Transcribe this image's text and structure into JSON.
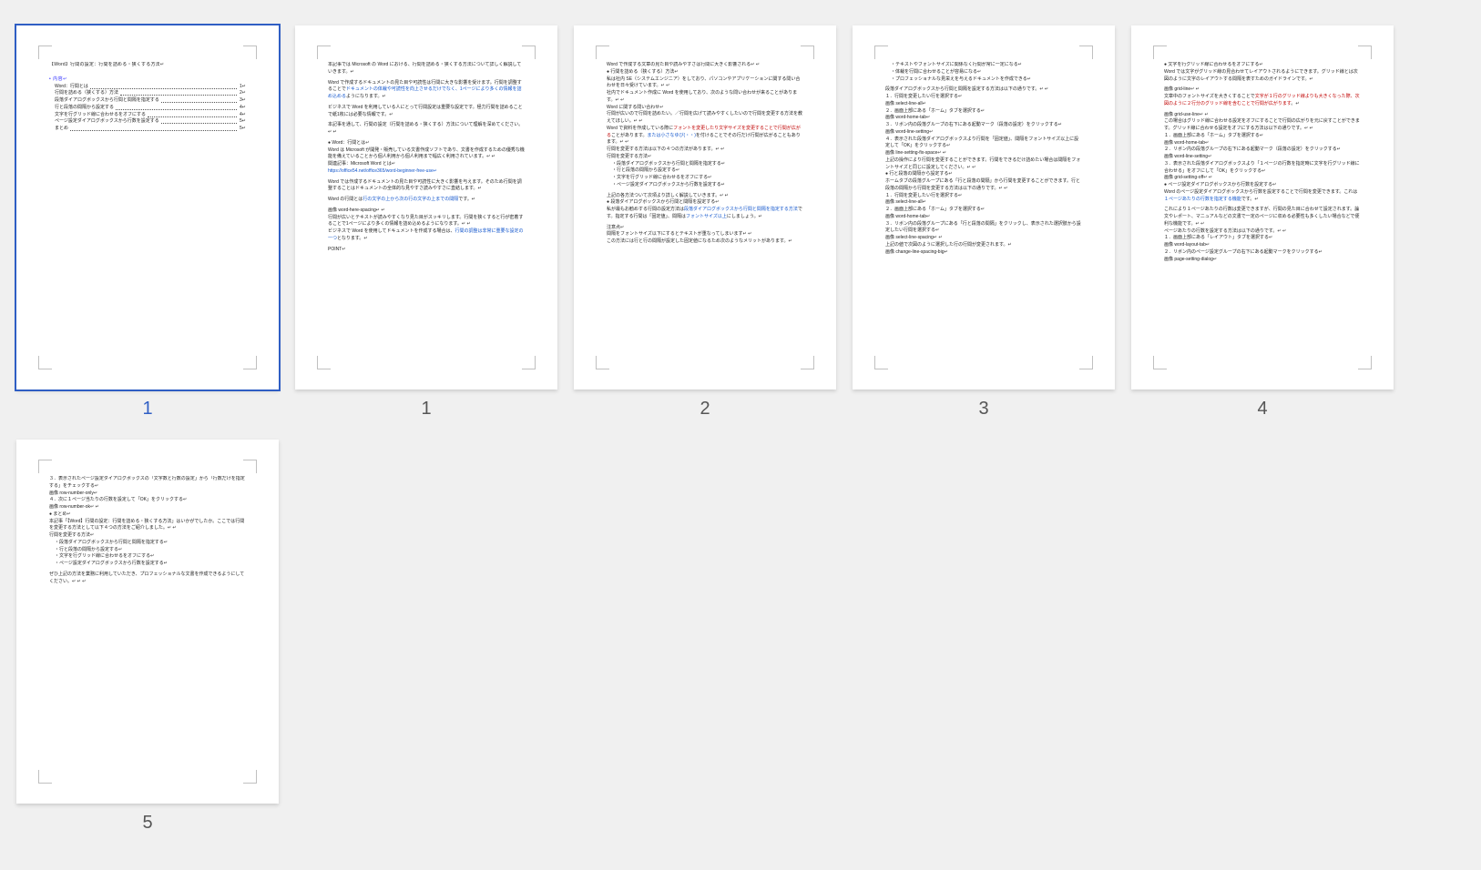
{
  "pages": [
    {
      "num": "1",
      "selected": true,
      "kind": "cover",
      "title": "【Word】行間の設定：行間を詰める・狭くする方法↵",
      "tocHead": "• 内容↵",
      "toc": [
        [
          "Word：行間とは",
          "1↵"
        ],
        [
          "行間を詰める（狭くする）方法",
          "2↵"
        ],
        [
          "段落ダイアログボックスから行間と間隔を指定する",
          "3↵"
        ],
        [
          "行と段落の間隔から設定する",
          "4↵"
        ],
        [
          "文字を行グリッド線に合わせるをオフにする",
          "4↵"
        ],
        [
          "ページ設定ダイアログボックスから行数を設定する",
          "5↵"
        ],
        [
          "まとめ",
          "5↵"
        ]
      ]
    },
    {
      "num": "1",
      "kind": "body",
      "blocks": [
        {
          "t": "p",
          "v": "本記事では Microsoft の Word における、行間を詰める・狭くする方法について詳しく解説していきます。↵"
        },
        {
          "t": "sp"
        },
        {
          "t": "mix",
          "parts": [
            {
              "v": "Word で作成するドキュメントの見た目や可読性は行間に大きな影響を受けます。行間を調整することで"
            },
            {
              "v": "ドキュメントの体裁や可読性を向上させるだけでなく、1ページにより多くの情報を詰め込める",
              "c": "lnk"
            },
            {
              "v": "ようになります。↵"
            }
          ]
        },
        {
          "t": "sp"
        },
        {
          "t": "p",
          "v": "ビジネスで Word を利用している人にとって行間設定は重要な設定です。極力行間を詰めることで紙1枚には必要な情報です。↵"
        },
        {
          "t": "sp"
        },
        {
          "t": "p",
          "v": "本記事を通して、行間の設定（行間を詰める・狭くする）方法について理解を深めてください。↵  ↵"
        },
        {
          "t": "sp"
        },
        {
          "t": "b",
          "v": "Word：行間とは↵"
        },
        {
          "t": "p",
          "v": "Word は Microsoft が開発・販売している文書作成ソフトであり、文書を作成するための優秀な機能を備えていることから個人利用から個人利用まで幅広く利用されています。↵  ↵"
        },
        {
          "t": "p",
          "v": "関連記事：Microsoft Word とは↵"
        },
        {
          "t": "p",
          "v": "https://office54.net/office365/word-beginner-free-use↵",
          "c": "lnk"
        },
        {
          "t": "sp"
        },
        {
          "t": "p",
          "v": "Word では作成するドキュメントの見た目や可読性に大きく影響を与えます。そのため行間を調整することはドキュメントの全体的な見やすさ読みやすさに直結します。↵"
        },
        {
          "t": "sp"
        },
        {
          "t": "mix",
          "parts": [
            {
              "v": "Word の行間とは"
            },
            {
              "v": "行の文字の上から次の行の文字の上までの間隔",
              "c": "lnk"
            },
            {
              "v": "です。↵"
            }
          ]
        },
        {
          "t": "sp"
        },
        {
          "t": "p",
          "v": "画像  word-here-spacing↵  ↵"
        },
        {
          "t": "p",
          "v": "行間が広いとテキストが読みやすくなり見た目がスッキリします。行間を狭くすると行が密着することで1ページにより多くの情報を詰め込めるようになります。↵  ↵"
        },
        {
          "t": "mix",
          "parts": [
            {
              "v": "ビジネスで Word を使用してドキュメントを作成する場合は、"
            },
            {
              "v": "行間の調整は非常に重要な設定の一つ",
              "c": "lnk"
            },
            {
              "v": "となります。↵"
            }
          ]
        },
        {
          "t": "sp"
        },
        {
          "t": "p",
          "v": "POINT↵"
        }
      ]
    },
    {
      "num": "2",
      "kind": "body",
      "blocks": [
        {
          "t": "p",
          "v": "Word で作成する文章の見た目や読みやすさは行間に大きく影響される↵  ↵"
        },
        {
          "t": "b",
          "v": "行間を詰める（狭くする）方法↵"
        },
        {
          "t": "p",
          "v": "私は社内 SE（システムエンジニア）をしており、パソコンやアプリケーションに関する問い合わせを日々受けています。↵  ↵"
        },
        {
          "t": "p",
          "v": "社内でドキュメント作成に Word を使用しており、次のような問い合わせが来ることがあります。↵  ↵"
        },
        {
          "t": "p",
          "v": "Word に関する問い合わせ↵"
        },
        {
          "t": "p",
          "v": "行間が広いので行間を詰めたい。／行間を広げて読みやすくしたいので行間を変更する方法を教えてほしい。↵  ↵"
        },
        {
          "t": "mix",
          "parts": [
            {
              "v": "Word で資料を作成している際に"
            },
            {
              "v": "フォントを変更したり文字サイズを変更することで行間が広がる",
              "c": "red"
            },
            {
              "v": "ことがあります。"
            },
            {
              "v": "または小さなゆび(・・)",
              "c": "lnk"
            },
            {
              "v": "を付けることでその行だけ行間が広がることもあります。↵  ↵"
            }
          ]
        },
        {
          "t": "p",
          "v": "行間を変更する方法は以下の４つの方法があります。↵  ↵"
        },
        {
          "t": "p",
          "v": "行間を変更する方法↵"
        },
        {
          "t": "d",
          "v": "段落ダイアログボックスから行間と間隔を指定する↵"
        },
        {
          "t": "d",
          "v": "行と段落の間隔から設定する↵"
        },
        {
          "t": "d",
          "v": "文字を行グリッド線に合わせるをオフにする↵"
        },
        {
          "t": "d",
          "v": "ページ設定ダイアログボックスから行数を設定する↵"
        },
        {
          "t": "sp"
        },
        {
          "t": "p",
          "v": "上記の各方法ついて次項より詳しく解説していきます。↵  ↵"
        },
        {
          "t": "b",
          "v": "段落ダイアログボックスから行間と間隔を設定する↵"
        },
        {
          "t": "mix",
          "parts": [
            {
              "v": "私が最もお勧めする行間の設定方法は"
            },
            {
              "v": "段落ダイアログボックスから行間と間隔を指定する方法",
              "c": "lnk"
            },
            {
              "v": "です。指定する行間は「固定値」、間隔は"
            },
            {
              "v": "フォントサイズ以上",
              "c": "lnk"
            },
            {
              "v": "にしましょう。↵"
            }
          ]
        },
        {
          "t": "sp"
        },
        {
          "t": "p",
          "v": "注意点↵"
        },
        {
          "t": "p",
          "v": "間隔をフォントサイズ以下にするとテキストが重なってしまいます↵  ↵"
        },
        {
          "t": "p",
          "v": "この方法には行と行の間隔が設定した固定値になるため次のようなメリットがあります。↵"
        }
      ]
    },
    {
      "num": "3",
      "kind": "body",
      "blocks": [
        {
          "t": "d",
          "v": "テキストやフォントサイズに関係なく行間が常に一定になる↵"
        },
        {
          "t": "d",
          "v": "体裁を行間に合わせることが容易になる↵"
        },
        {
          "t": "d",
          "v": "プロフェッショナルな見栄えを与えるドキュメントを作成できる↵"
        },
        {
          "t": "sp"
        },
        {
          "t": "p",
          "v": "段落ダイアログボックスから行間と間隔を設定する方法は以下の通りです。↵  ↵"
        },
        {
          "t": "p",
          "v": "１．行間を変更したい行を選択する↵"
        },
        {
          "t": "p",
          "v": "画像  select-line-all↵"
        },
        {
          "t": "p",
          "v": "２．画面上部にある「ホーム」タブを選択する↵"
        },
        {
          "t": "p",
          "v": "画像  word-home-tab↵"
        },
        {
          "t": "p",
          "v": "３．リボン内の段落グループの右下にある起動マーク（段落の設定）をクリックする↵"
        },
        {
          "t": "p",
          "v": "画像  word-line-setting↵"
        },
        {
          "t": "p",
          "v": "４．表示された段落ダイアログボックスより行間を「固定値」、間隔をフォントサイズ以上に設定して「OK」をクリックする↵"
        },
        {
          "t": "p",
          "v": "画像  line-setting-fix-space↵  ↵"
        },
        {
          "t": "p",
          "v": "上記の操作により行間を変更することができます。行間をできるだけ詰めたい場合は間隔をフォントサイズと同じに設定してください。↵  ↵"
        },
        {
          "t": "b",
          "v": "行と段落の間隔から設定する↵"
        },
        {
          "t": "p",
          "v": "ホームタブの段落グループにある「行と段落の間隔」から行間を変更することができます。行と段落の間隔から行間を変更する方法は以下の通りです。↵  ↵"
        },
        {
          "t": "p",
          "v": "１．行間を変更したい行を選択する↵"
        },
        {
          "t": "p",
          "v": "画像  select-line-all↵"
        },
        {
          "t": "p",
          "v": "２．画面上部にある「ホーム」タブを選択する↵"
        },
        {
          "t": "p",
          "v": "画像  word-home-tab↵"
        },
        {
          "t": "p",
          "v": "３．リボン内の段落グループにある「行と段落の間隔」をクリックし、表示された選択肢から設定したい行間を選択する↵"
        },
        {
          "t": "p",
          "v": "画像  select-line-spacing↵  ↵"
        },
        {
          "t": "p",
          "v": "上記の値で次図のように選択した行の行間が変更されます。↵"
        },
        {
          "t": "p",
          "v": "画像  change-line-spacing-big↵"
        }
      ]
    },
    {
      "num": "4",
      "kind": "body",
      "blocks": [
        {
          "t": "b",
          "v": "文字を行グリッド線に合わせるをオフにする↵"
        },
        {
          "t": "p",
          "v": "Word では文字がグリッド線の見合わせてレイアウトされるようにできます。グリッド線とは次図のように文字のレイアウトする間隔を表すためのガイドラインです。↵"
        },
        {
          "t": "sp"
        },
        {
          "t": "p",
          "v": "画像  grid-line↵  ↵"
        },
        {
          "t": "mix",
          "parts": [
            {
              "v": "文章中のフォントサイズを大きくすることで"
            },
            {
              "v": "文字が１行のグリッド線よりも大きくなった際、次図のように２行分のグリッド線を含むことで行間が広がります",
              "c": "red"
            },
            {
              "v": "。↵"
            }
          ]
        },
        {
          "t": "sp"
        },
        {
          "t": "p",
          "v": "画像  grid-use-line↵  ↵"
        },
        {
          "t": "p",
          "v": "この場合はグリッド線に合わせる設定をオフにすることで行間の広がりを元に戻すことができます。グリッド線に合わせる設定をオフにする方法は以下の通りです。↵  ↵"
        },
        {
          "t": "p",
          "v": "１．画面上部にある「ホーム」タブを選択する↵"
        },
        {
          "t": "p",
          "v": "画像  word-home-tab↵"
        },
        {
          "t": "p",
          "v": "２．リボン内の段落グループの右下にある起動マーク（段落の設定）をクリックする↵"
        },
        {
          "t": "p",
          "v": "画像  word-line-setting↵"
        },
        {
          "t": "p",
          "v": "３．表示された段落ダイアログボックスより「１ページの行数を指定時に文字を行グリッド線に合わせる」をオフにして「OK」をクリックする↵"
        },
        {
          "t": "p",
          "v": "画像  grid-setting-off↵  ↵"
        },
        {
          "t": "b",
          "v": "ページ設定ダイアログボックスから行数を設定する↵"
        },
        {
          "t": "mix",
          "parts": [
            {
              "v": "Word のページ設定ダイアログボックスから行数を設定することで行間を変更できます。これは"
            },
            {
              "v": "１ページあたりの行数を指定する機能",
              "c": "lnk"
            },
            {
              "v": "です。↵"
            }
          ]
        },
        {
          "t": "sp"
        },
        {
          "t": "p",
          "v": "これにより１ページあたりの行数は変更できますが、行間の見た目に合わせて設定されます。論文やレポート、マニュアルなどの文書で一定のページに収める必要性も多くしたい場合などで便利な機能です。↵  ↵"
        },
        {
          "t": "p",
          "v": "ページあたりの行数を設定する方法は以下の通りです。↵  ↵"
        },
        {
          "t": "p",
          "v": "１．画面上部にある「レイアウト」タブを選択する↵"
        },
        {
          "t": "p",
          "v": "画像  word-layout-tab↵"
        },
        {
          "t": "p",
          "v": "２．リボン内のページ設定グループの右下にある起動マークをクリックする↵"
        },
        {
          "t": "p",
          "v": "画像  page-setting-dialog↵"
        }
      ]
    },
    {
      "num": "5",
      "kind": "body",
      "blocks": [
        {
          "t": "p",
          "v": "３．表示されたページ設定ダイアログボックスの「文字数と行数の設定」から「行数だけを指定する」をチェックする↵"
        },
        {
          "t": "p",
          "v": "画像  row-number-only↵"
        },
        {
          "t": "p",
          "v": "４．次に１ページ当たりの行数を設定して「OK」をクリックする↵"
        },
        {
          "t": "p",
          "v": "画像  row-number-ok↵  ↵"
        },
        {
          "t": "b",
          "v": "まとめ↵"
        },
        {
          "t": "p",
          "v": "本記事「【Word】行間の設定：行間を詰める・狭くする方法」はいかがでしたか。ここでは行間を変更する方法として以下４つの方法をご紹介しました。↵  ↵"
        },
        {
          "t": "p",
          "v": "行間を変更する方法↵"
        },
        {
          "t": "d",
          "v": "段落ダイアログボックスから行間と間隔を指定する↵"
        },
        {
          "t": "d",
          "v": "行と段落の間隔から設定する↵"
        },
        {
          "t": "d",
          "v": "文字を行グリッド線に合わせるをオフにする↵"
        },
        {
          "t": "d",
          "v": "ページ設定ダイアログボックスから行数を設定する↵"
        },
        {
          "t": "sp"
        },
        {
          "t": "p",
          "v": "ぜひ上記の方法を業務に利用していただき、プロフェッショナルな文書を作成できるようにしてください。↵  ↵  ↵"
        }
      ]
    }
  ]
}
